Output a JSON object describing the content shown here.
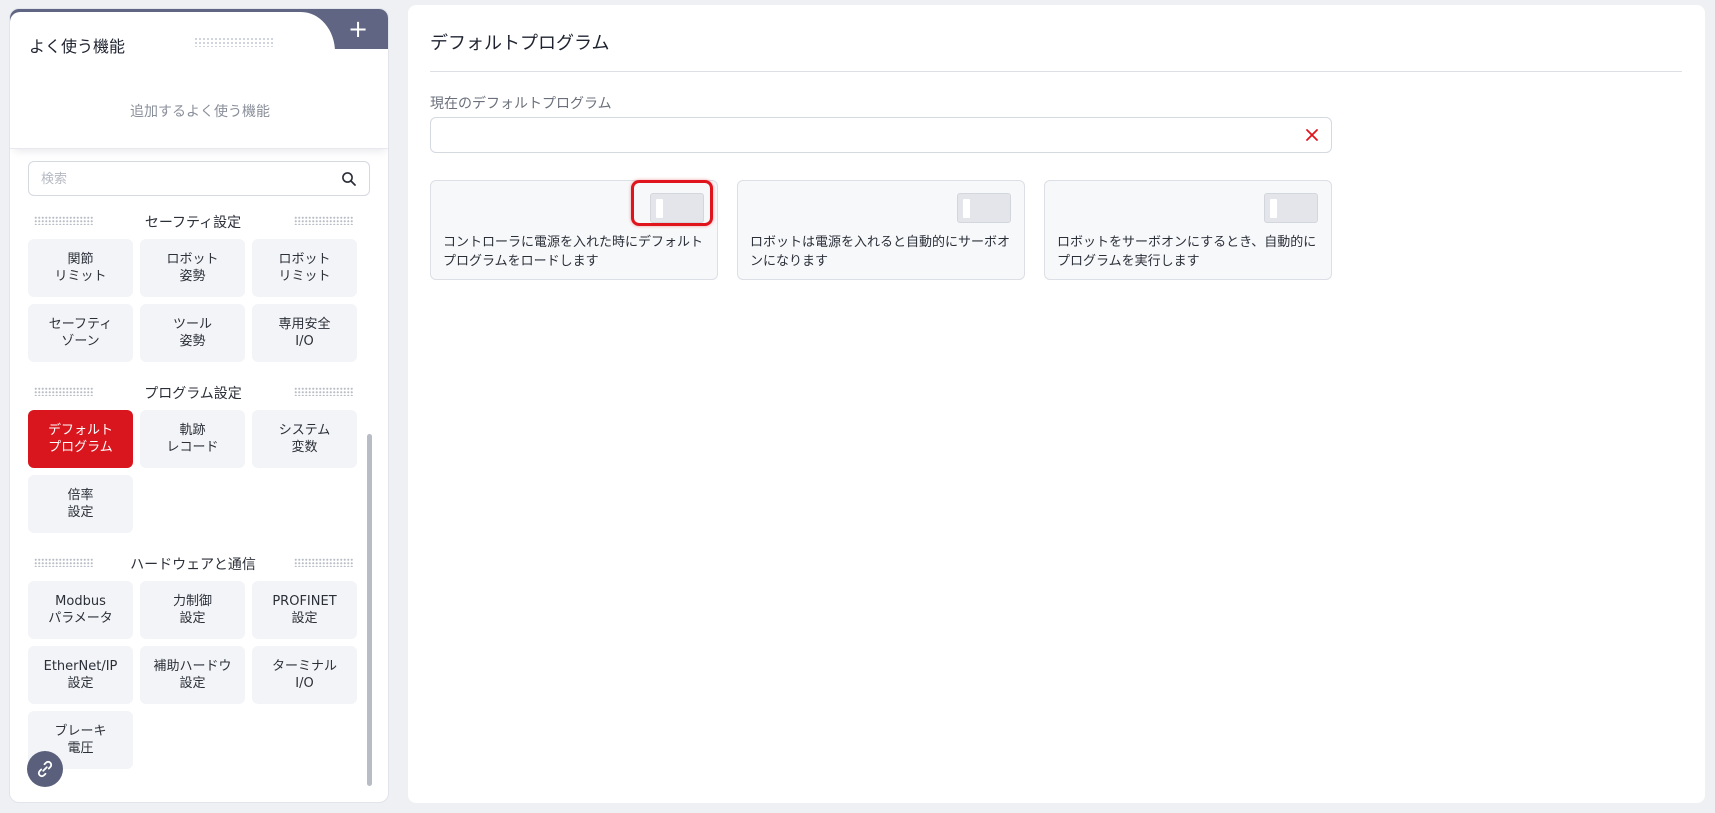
{
  "sidebar": {
    "favorites_title": "よく使う機能",
    "favorites_add": "+",
    "favorites_empty": "追加するよく使う機能",
    "search_placeholder": "検索",
    "sections": [
      {
        "title": "セーフティ設定",
        "items": [
          "関節\nリミット",
          "ロボット\n姿勢",
          "ロボット\nリミット",
          "セーフティ\nゾーン",
          "ツール\n姿勢",
          "専用安全\nI/O"
        ]
      },
      {
        "title": "プログラム設定",
        "items": [
          "デフォルト\nプログラム",
          "軌跡\nレコード",
          "システム\n変数",
          "倍率\n設定"
        ]
      },
      {
        "title": "ハードウェアと通信",
        "items": [
          "Modbus\nパラメータ",
          "力制御\n設定",
          "PROFINET\n設定",
          "EtherNet/IP\n設定",
          "補助ハードウ\n設定",
          "ターミナル\nI/O",
          "ブレーキ\n電圧"
        ]
      }
    ],
    "active_item": "デフォルト\nプログラム"
  },
  "main": {
    "title": "デフォルトプログラム",
    "current_label": "現在のデフォルトプログラム",
    "current_value": "",
    "options": [
      {
        "text": "コントローラに電源を入れた時にデフォルトプログラムをロードします",
        "enabled": false
      },
      {
        "text": "ロボットは電源を入れると自動的にサーボオンになります",
        "enabled": false
      },
      {
        "text": "ロボットをサーボオンにするとき、自動的にプログラムを実行します",
        "enabled": false
      }
    ]
  },
  "colors": {
    "accent": "#d9151d",
    "header_band": "#5f6583",
    "tile_bg": "#f3f4f7",
    "highlight": "#e0141c"
  },
  "icons": {
    "search": "search-icon",
    "clear": "close-icon",
    "add": "plus-icon",
    "float": "link-icon"
  }
}
